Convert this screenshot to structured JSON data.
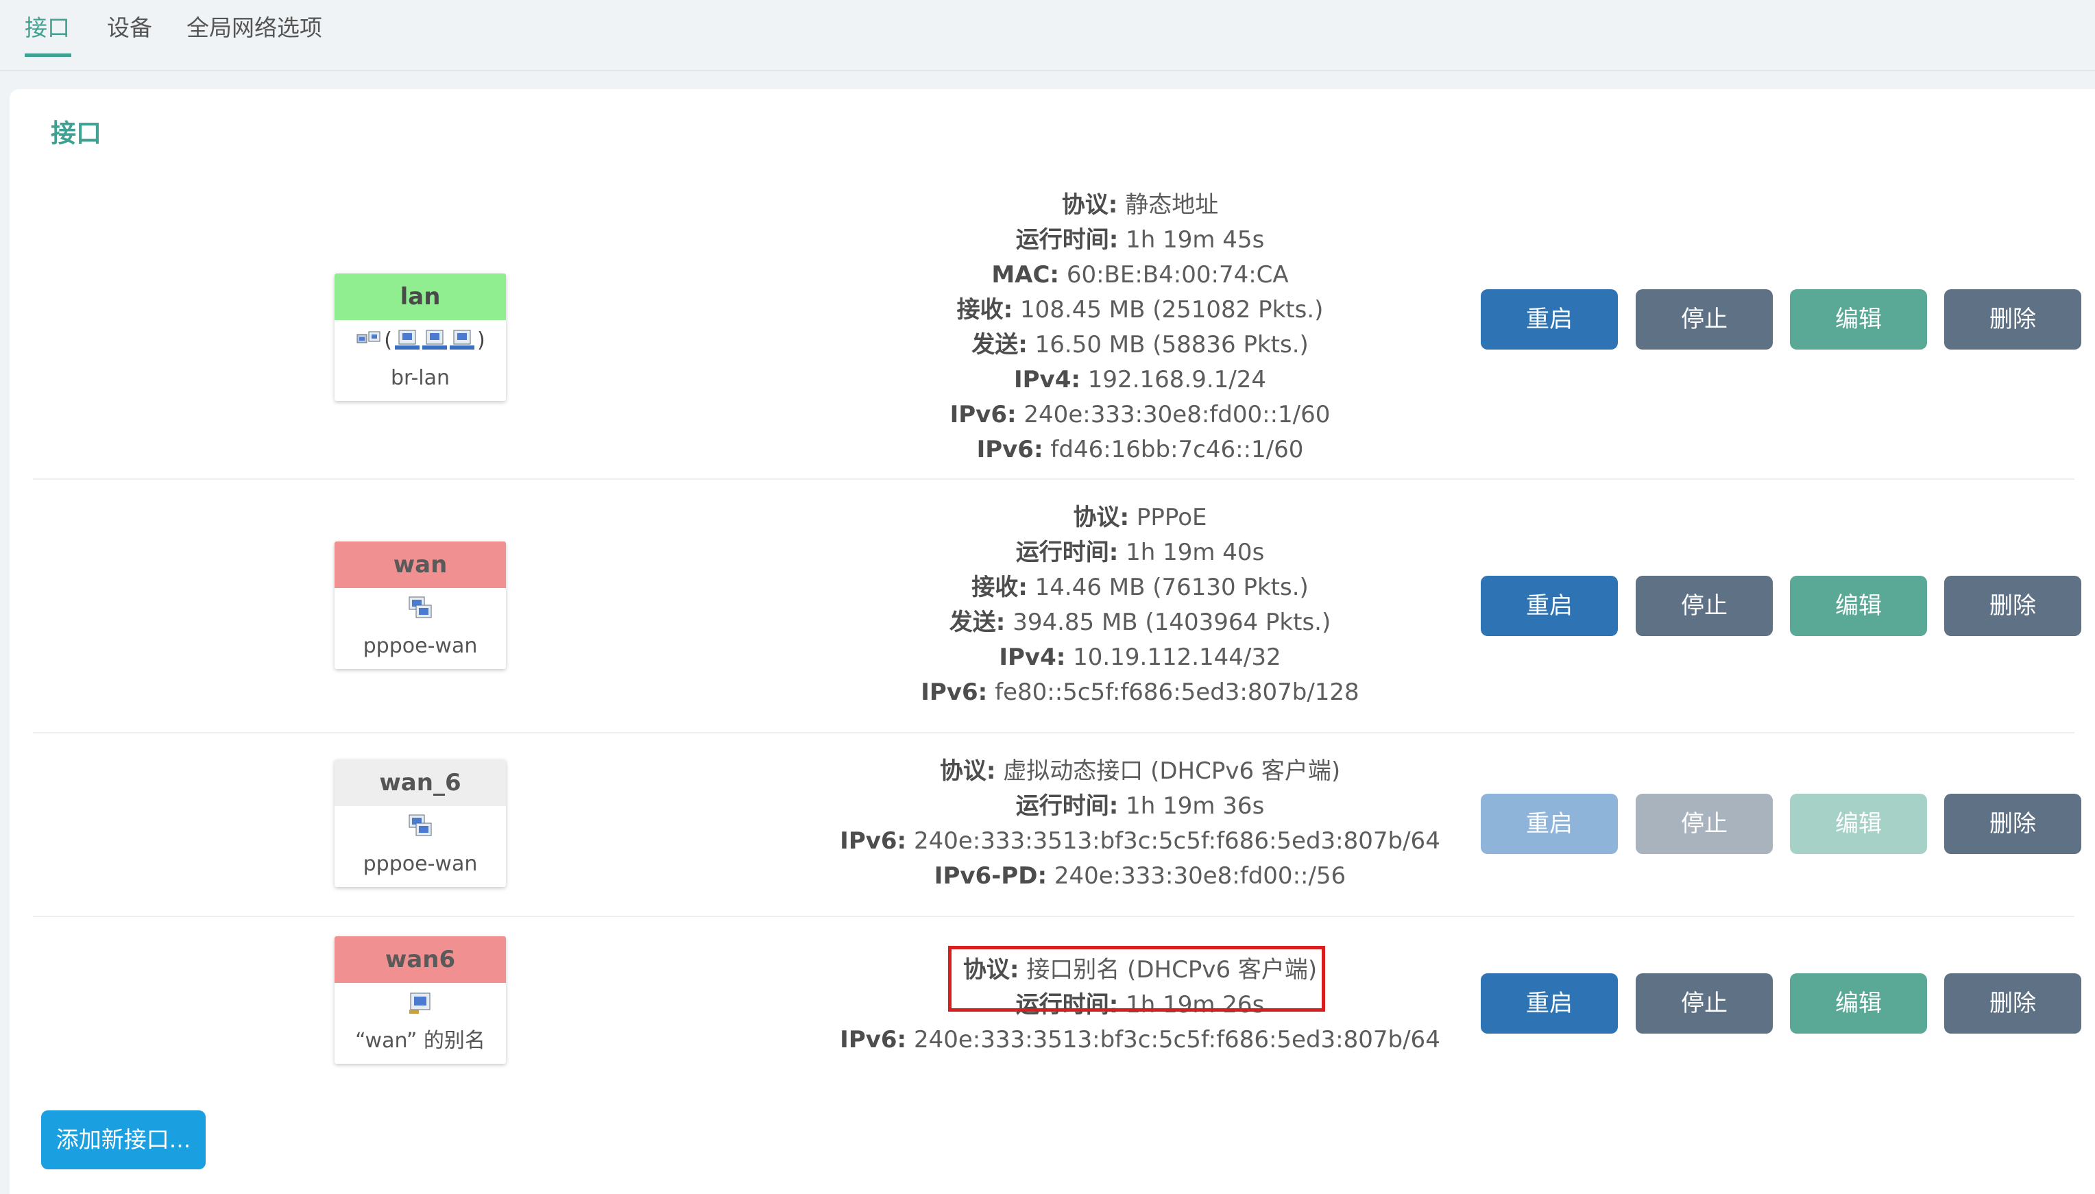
{
  "tabs": [
    {
      "label": "接口"
    },
    {
      "label": "设备"
    },
    {
      "label": "全局网络选项"
    }
  ],
  "panel": {
    "title": "接口"
  },
  "interfaces": [
    {
      "name": "lan",
      "device": "br-lan",
      "status_color": "#90ee90",
      "icons": [
        "bridge-icon",
        "ethernet-icon",
        "ethernet-icon",
        "ethernet-icon"
      ],
      "info": [
        {
          "k": "协议:",
          "v": "静态地址"
        },
        {
          "k": "运行时间:",
          "v": "1h 19m 45s"
        },
        {
          "k": "MAC:",
          "v": "60:BE:B4:00:74:CA"
        },
        {
          "k": "接收:",
          "v": "108.45 MB (251082 Pkts.)"
        },
        {
          "k": "发送:",
          "v": "16.50 MB (58836 Pkts.)"
        },
        {
          "k": "IPv4:",
          "v": "192.168.9.1/24"
        },
        {
          "k": "IPv6:",
          "v": "240e:333:30e8:fd00::1/60"
        },
        {
          "k": "IPv6:",
          "v": "fd46:16bb:7c46::1/60"
        }
      ]
    },
    {
      "name": "wan",
      "device": "pppoe-wan",
      "status_color": "#f09090",
      "icons": [
        "tunnel-icon"
      ],
      "info": [
        {
          "k": "协议:",
          "v": "PPPoE"
        },
        {
          "k": "运行时间:",
          "v": "1h 19m 40s"
        },
        {
          "k": "接收:",
          "v": "14.46 MB (76130 Pkts.)"
        },
        {
          "k": "发送:",
          "v": "394.85 MB (1403964 Pkts.)"
        },
        {
          "k": "IPv4:",
          "v": "10.19.112.144/32"
        },
        {
          "k": "IPv6:",
          "v": "fe80::5c5f:f686:5ed3:807b/128"
        }
      ]
    },
    {
      "name": "wan_6",
      "device": "pppoe-wan",
      "status_color": "#eeeeee",
      "icons": [
        "tunnel-icon"
      ],
      "info": [
        {
          "k": "协议:",
          "v": "虚拟动态接口 (DHCPv6 客户端)"
        },
        {
          "k": "运行时间:",
          "v": "1h 19m 36s"
        },
        {
          "k": "IPv6:",
          "v": "240e:333:3513:bf3c:5c5f:f686:5ed3:807b/64"
        },
        {
          "k": "IPv6-PD:",
          "v": "240e:333:30e8:fd00::/56"
        }
      ]
    },
    {
      "name": "wan6",
      "device": "“wan” 的别名",
      "status_color": "#f09090",
      "icons": [
        "alias-icon"
      ],
      "info": [
        {
          "k": "协议:",
          "v": "接口别名 (DHCPv6 客户端)"
        },
        {
          "k": "运行时间:",
          "v": "1h 19m 26s"
        },
        {
          "k": "IPv6:",
          "v": "240e:333:3513:bf3c:5c5f:f686:5ed3:807b/64"
        }
      ]
    }
  ],
  "buttons": {
    "restart": "重启",
    "stop": "停止",
    "edit": "编辑",
    "delete": "删除"
  },
  "add_button": "添加新接口...",
  "colors": {
    "accent": "#3fa191",
    "restart": "#2e74b5",
    "stop": "#5f7285",
    "edit": "#5aa896",
    "add": "#1a9fe0",
    "highlight": "#d81e1e"
  }
}
